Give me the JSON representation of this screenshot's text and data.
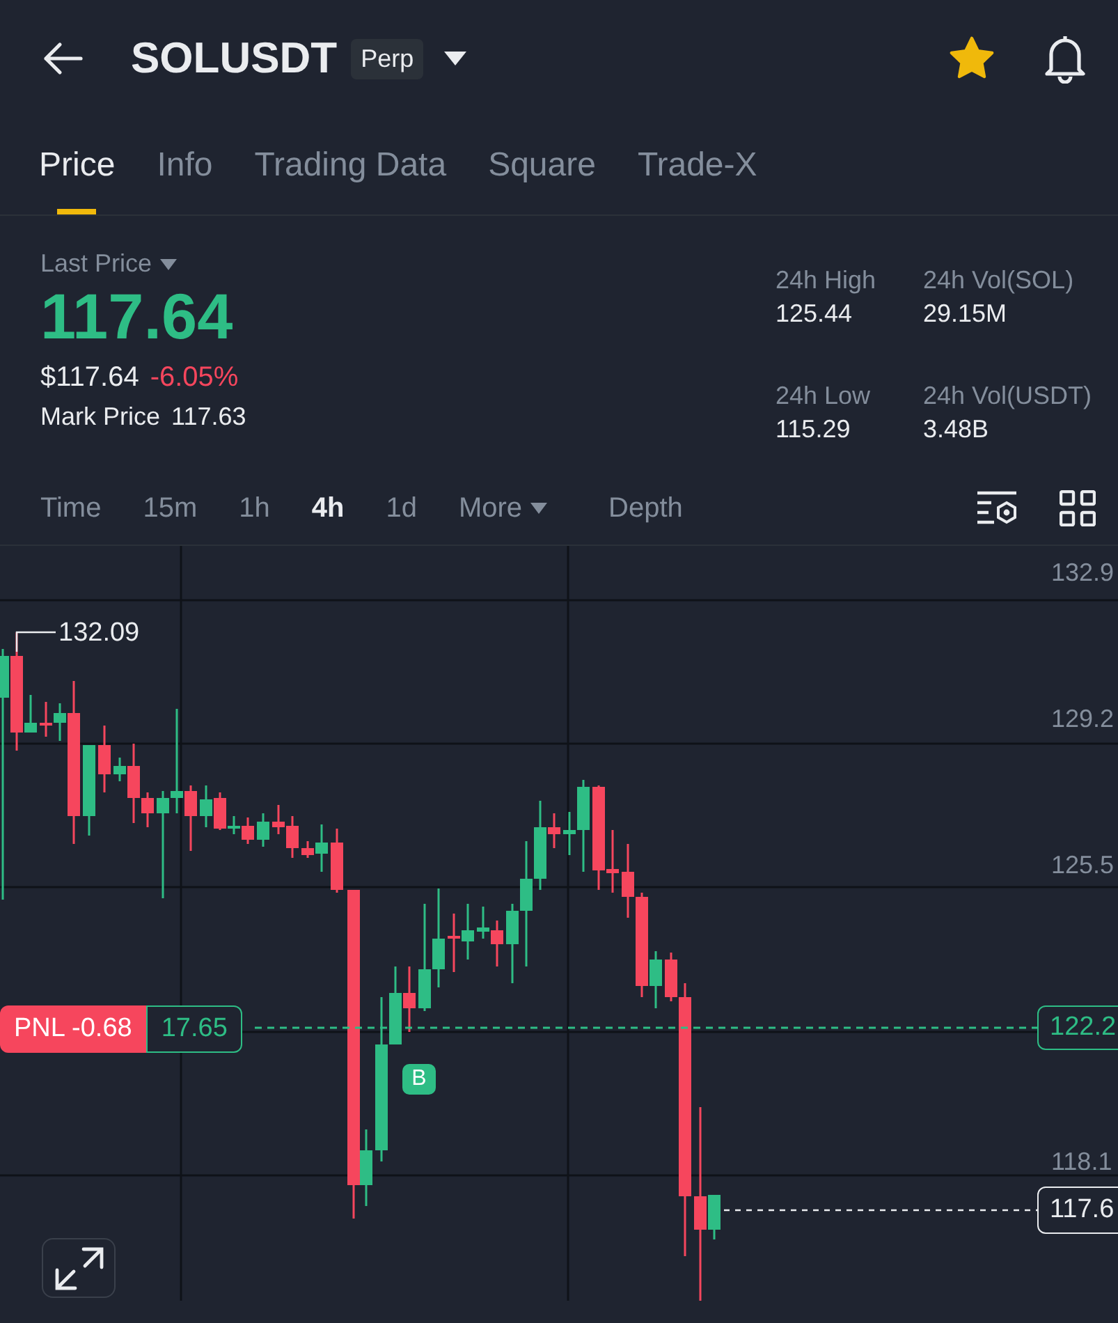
{
  "header": {
    "symbol": "SOLUSDT",
    "badge": "Perp",
    "favorite": true
  },
  "tabs": [
    {
      "label": "Price",
      "selected": true
    },
    {
      "label": "Info",
      "selected": false
    },
    {
      "label": "Trading Data",
      "selected": false
    },
    {
      "label": "Square",
      "selected": false
    },
    {
      "label": "Trade-X",
      "selected": false
    }
  ],
  "price": {
    "label": "Last Price",
    "value": "117.64",
    "usd": "$117.64",
    "change": "-6.05%",
    "change_negative": true,
    "mark_label": "Mark Price",
    "mark_value": "117.63"
  },
  "stats": [
    {
      "label": "24h High",
      "value": "125.44"
    },
    {
      "label": "24h Vol(SOL)",
      "value": "29.15M"
    },
    {
      "label": "24h Low",
      "value": "115.29"
    },
    {
      "label": "24h Vol(USDT)",
      "value": "3.48B"
    }
  ],
  "intervals": [
    {
      "label": "Time",
      "selected": false,
      "kind": "plain"
    },
    {
      "label": "15m",
      "selected": false,
      "kind": "plain"
    },
    {
      "label": "1h",
      "selected": false,
      "kind": "plain"
    },
    {
      "label": "4h",
      "selected": true,
      "kind": "plain"
    },
    {
      "label": "1d",
      "selected": false,
      "kind": "plain"
    },
    {
      "label": "More",
      "selected": false,
      "kind": "dropdown"
    },
    {
      "label": "Depth",
      "selected": false,
      "kind": "plain"
    }
  ],
  "chart": {
    "axis_labels": [
      "132.9",
      "129.2",
      "125.5",
      "118.1"
    ],
    "high_label": "132.09",
    "position": {
      "pnl": "PNL -0.68",
      "value": "17.65",
      "entry": "122.2"
    },
    "last_price_tag": "117.6",
    "trade_marker": "B"
  }
}
